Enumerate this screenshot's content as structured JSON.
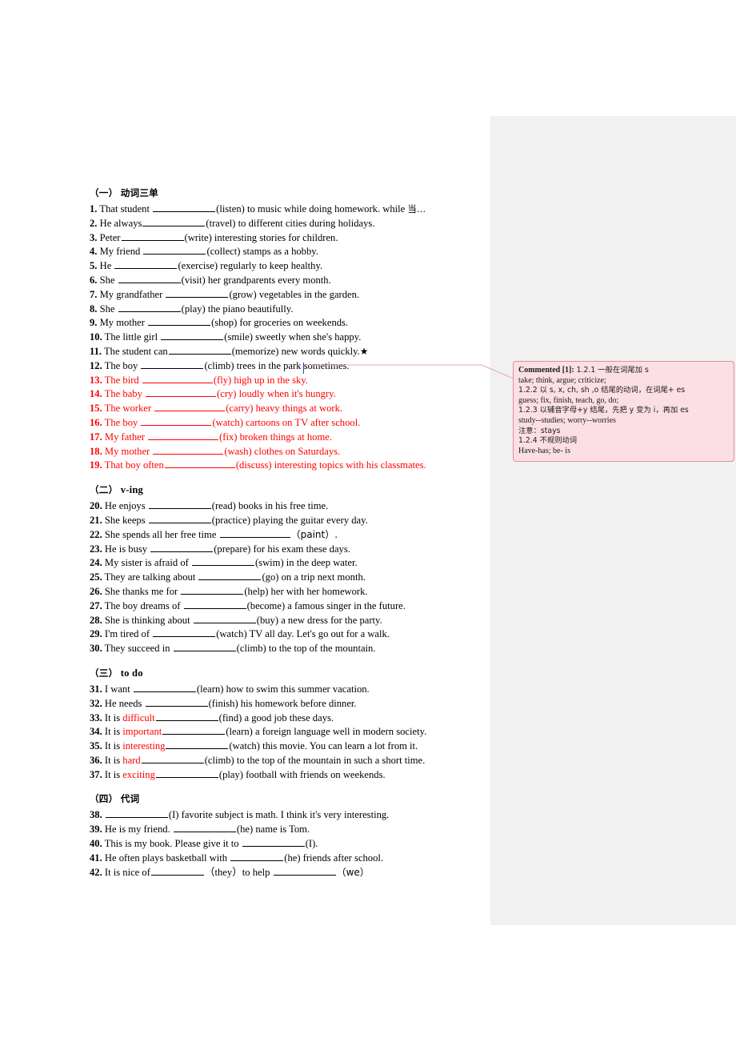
{
  "document": {
    "sections": [
      {
        "id": "section-1",
        "heading_cn": "（一）",
        "heading_label": "动词三单",
        "items": [
          {
            "num": "1.",
            "pre": "That student ",
            "blank": "b-lg",
            "post": "(listen) to music while doing homework. while ",
            "tail_cn": "当…",
            "color": "black"
          },
          {
            "num": "2.",
            "pre": "He always",
            "blank": "b-lg",
            "post": "(travel) to different cities during holidays.",
            "color": "black"
          },
          {
            "num": "3.",
            "pre": "Peter",
            "blank": "b-lg",
            "post": "(write) interesting stories for children.",
            "color": "black"
          },
          {
            "num": "4.",
            "pre": "My friend ",
            "blank": "b-lg",
            "post": "(collect) stamps as a hobby.",
            "color": "black"
          },
          {
            "num": "5.",
            "pre": "He ",
            "blank": "b-lg",
            "post": "(exercise) regularly to keep healthy.",
            "color": "black"
          },
          {
            "num": "6.",
            "pre": "She ",
            "blank": "b-lg",
            "post": "(visit) her grandparents every month.",
            "color": "black"
          },
          {
            "num": "7.",
            "pre": "My grandfather ",
            "blank": "b-lg",
            "post": "(grow) vegetables in the garden.",
            "color": "black"
          },
          {
            "num": "8.",
            "pre": "She ",
            "blank": "b-lg",
            "post": "(play) the piano beautifully.",
            "color": "black"
          },
          {
            "num": "9.",
            "pre": "My mother ",
            "blank": "b-lg",
            "post": "(shop) for groceries on weekends.",
            "color": "black"
          },
          {
            "num": "10.",
            "pre": "The little girl ",
            "blank": "b-lg",
            "post": "(smile) sweetly when she's happy.",
            "color": "black"
          },
          {
            "num": "11.",
            "pre": "The student can",
            "blank": "b-lg",
            "post": "(memorize) new words quickly.",
            "star": "★",
            "color": "black"
          },
          {
            "num": "12.",
            "pre": "The boy ",
            "blank": "b-lg",
            "post": "(climb) trees in the park sometimes.",
            "color": "black"
          },
          {
            "num": "13.",
            "pre": "The bird ",
            "blank": "b-xl",
            "post": "(fly) high up in the sky.",
            "color": "red",
            "commented": true
          },
          {
            "num": "14.",
            "pre": "The baby ",
            "blank": "b-xl",
            "post": "(cry) loudly when it's hungry.",
            "color": "red"
          },
          {
            "num": "15.",
            "pre": "The worker ",
            "blank": "b-xl",
            "post": "(carry) heavy things at work.",
            "color": "red"
          },
          {
            "num": "16.",
            "pre": "The boy ",
            "blank": "b-xl",
            "post": "(watch) cartoons on TV after school.",
            "color": "red"
          },
          {
            "num": "17.",
            "pre": "My father ",
            "blank": "b-xl",
            "post": "(fix) broken things at home.",
            "color": "red"
          },
          {
            "num": "18.",
            "pre": "My mother ",
            "blank": "b-xl",
            "post": "(wash) clothes on Saturdays.",
            "color": "red"
          },
          {
            "num": "19.",
            "pre": "That boy often",
            "blank": "b-xl",
            "post": "(discuss) interesting topics with his classmates.",
            "color": "red"
          }
        ]
      },
      {
        "id": "section-2",
        "heading_cn": "（二）",
        "heading_label": "v-ing",
        "items": [
          {
            "num": "20.",
            "pre": "He enjoys ",
            "blank": "b-lg",
            "post": "(read) books in his free time.",
            "color": "black"
          },
          {
            "num": "21.",
            "pre": "She keeps ",
            "blank": "b-lg",
            "post": "(practice) playing the guitar every day.",
            "color": "black"
          },
          {
            "num": "22.",
            "pre": "She spends all her free time ",
            "blank": "b-xl",
            "post": "（paint）.",
            "color": "black",
            "fullwidth": true
          },
          {
            "num": "23.",
            "pre": "He is busy ",
            "blank": "b-lg",
            "post": "(prepare) for his exam these days.",
            "color": "black"
          },
          {
            "num": "24.",
            "pre": "My sister is afraid of ",
            "blank": "b-lg",
            "post": "(swim) in the deep water.",
            "color": "black"
          },
          {
            "num": "25.",
            "pre": "They are talking about ",
            "blank": "b-lg",
            "post": "(go) on a trip next month.",
            "color": "black"
          },
          {
            "num": "26.",
            "pre": "She thanks me for ",
            "blank": "b-lg",
            "post": "(help) her with her homework.",
            "color": "black"
          },
          {
            "num": "27.",
            "pre": "The boy dreams of ",
            "blank": "b-lg",
            "post": "(become) a famous singer in the future.",
            "color": "black"
          },
          {
            "num": "28.",
            "pre": "She is thinking about ",
            "blank": "b-lg",
            "post": "(buy) a new dress for the party.",
            "color": "black"
          },
          {
            "num": "29.",
            "pre": "I'm tired of ",
            "blank": "b-lg",
            "post": "(watch) TV all day. Let's go out for a walk.",
            "color": "black"
          },
          {
            "num": "30.",
            "pre": "They succeed in ",
            "blank": "b-lg",
            "post": "(climb) to the top of the mountain.",
            "color": "black"
          }
        ]
      },
      {
        "id": "section-3",
        "heading_cn": "（三）",
        "heading_label": "to do",
        "items": [
          {
            "num": "31.",
            "pre": "I want ",
            "blank": "b-lg",
            "post": "(learn) how to swim this summer vacation.",
            "color": "black"
          },
          {
            "num": "32.",
            "pre": "He needs ",
            "blank": "b-lg",
            "post": "(finish) his homework before dinner.",
            "color": "black"
          },
          {
            "num": "33.",
            "pre": "It is ",
            "red_word": "difficult",
            "blank": "b-lg",
            "post": "(find) a good job these days.",
            "color": "black"
          },
          {
            "num": "34.",
            "pre": "It is ",
            "red_word": "important",
            "blank": "b-lg",
            "post": "(learn) a foreign language well in modern society.",
            "color": "black"
          },
          {
            "num": "35.",
            "pre": "It is ",
            "red_word": "interesting",
            "blank": "b-lg",
            "post": "(watch) this movie. You can learn a lot from it.",
            "color": "black"
          },
          {
            "num": "36.",
            "pre": "It is ",
            "red_word": "hard",
            "blank": "b-lg",
            "post": "(climb) to the top of the mountain in such a short time.",
            "color": "black"
          },
          {
            "num": "37.",
            "pre": "It is ",
            "red_word": "exciting",
            "blank": "b-lg",
            "post": "(play) football with friends on weekends.",
            "color": "black"
          }
        ]
      },
      {
        "id": "section-4",
        "heading_cn": "（四）",
        "heading_label": "代词",
        "items": [
          {
            "num": "38.",
            "pre": "",
            "blank": "b-lg",
            "post": "(I) favorite subject is math. I think it's very interesting.",
            "color": "black"
          },
          {
            "num": "39.",
            "pre": "He is my friend. ",
            "blank": "b-lg",
            "post": "(he) name is Tom.",
            "color": "black"
          },
          {
            "num": "40.",
            "pre": "This is my book. Please give it to ",
            "blank": "b-lg",
            "post": "(I).",
            "color": "black"
          },
          {
            "num": "41.",
            "pre": "He often plays basketball with ",
            "blank": "b-md",
            "post": "(he) friends after school.",
            "color": "black"
          },
          {
            "num": "42.",
            "pre": "It is nice of",
            "blank": "b-md",
            "post": "（they）to help",
            "blank2": "b-lg",
            "post2": "（we）",
            "color": "black"
          }
        ]
      }
    ]
  },
  "comment": {
    "label": "Commented [1]:",
    "lines": [
      "1.2.1 一般在词尾加 s",
      "take; think, argue; criticize;",
      "1.2.2 以 s, x, ch, sh ,o 结尾的动词，在词尾+ es",
      "guess; fix, finish, teach, go, do;",
      "1.2.3 以辅音字母+y 结尾，先把 y 变为 i，再加 es",
      "study--studies; worry--worries",
      "注意：stays",
      "1.2.4 不规则动词",
      "Have-has; be- is"
    ],
    "first_line_rest": "1.2.1 一般在词尾加 s"
  },
  "colors": {
    "red": "#ff0000",
    "comment_bg": "#fbdfe4",
    "comment_border": "#e58ba0",
    "pane_bg": "#f1f1f1",
    "caret": "#2244bb"
  }
}
